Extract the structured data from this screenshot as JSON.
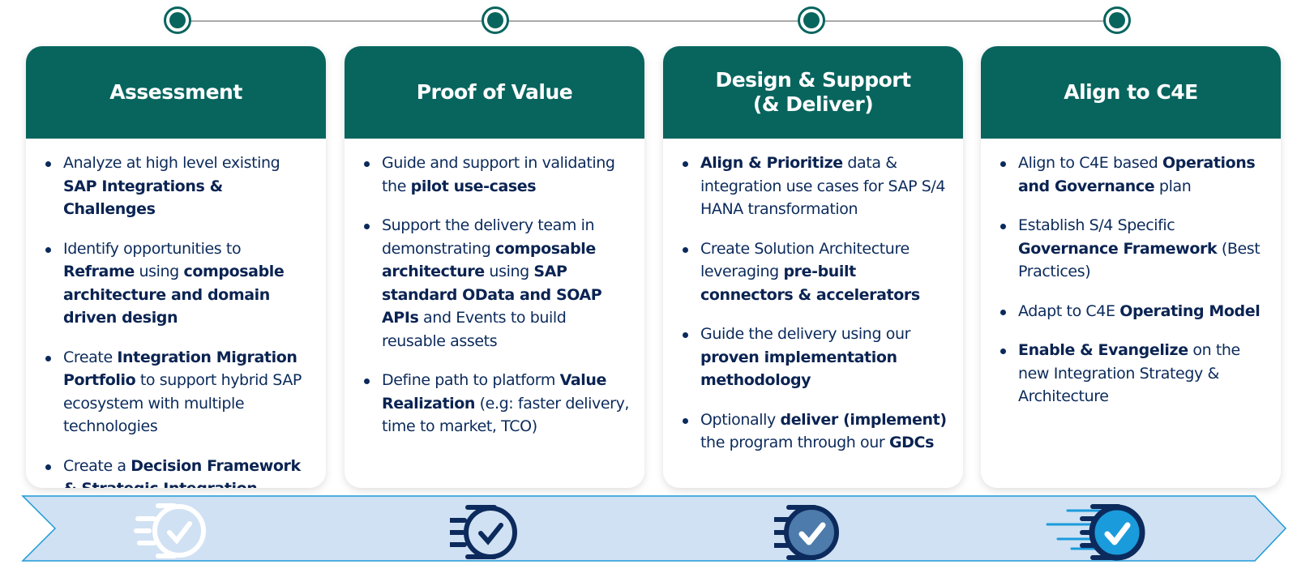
{
  "colors": {
    "header_bg": "#08655e",
    "header_text": "#ffffff",
    "body_text": "#0b2a5b",
    "ribbon_fill": "#d0e1f3",
    "ribbon_stroke": "#1e9ad6",
    "icon_navy": "#0c2a5c",
    "icon_mid_blue": "#4d7bab",
    "icon_bright_blue": "#1a9bdb",
    "timeline_line": "#a9a9a9"
  },
  "phases": [
    {
      "title": "Assessment",
      "icon": "speed-check-icon-faded",
      "bullets": [
        [
          {
            "t": "Analyze at high level existing "
          },
          {
            "t": "SAP Integrations & Challenges",
            "b": true
          }
        ],
        [
          {
            "t": "Identify opportunities to "
          },
          {
            "t": "Reframe",
            "b": true
          },
          {
            "t": " using "
          },
          {
            "t": "composable architecture and domain driven design",
            "b": true
          }
        ],
        [
          {
            "t": "Create "
          },
          {
            "t": "Integration Migration Portfolio",
            "b": true
          },
          {
            "t": " to support hybrid SAP ecosystem with multiple technologies"
          }
        ],
        [
          {
            "t": "Create a "
          },
          {
            "t": "Decision Framework & Strategic Integration Roadmap",
            "b": true
          }
        ]
      ]
    },
    {
      "title": "Proof of Value",
      "icon": "speed-check-icon-outline",
      "bullets": [
        [
          {
            "t": "Guide and support in validating the "
          },
          {
            "t": "pilot use-cases",
            "b": true
          }
        ],
        [
          {
            "t": "Support the delivery team in demonstrating "
          },
          {
            "t": "composable architecture",
            "b": true
          },
          {
            "t": " using  "
          },
          {
            "t": "SAP standard OData and SOAP APIs",
            "b": true
          },
          {
            "t": " and Events to build reusable assets"
          }
        ],
        [
          {
            "t": "Define path to platform "
          },
          {
            "t": "Value Realization",
            "b": true
          },
          {
            "t": " (e.g: faster delivery, time to market, TCO)"
          }
        ]
      ]
    },
    {
      "title": "Design & Support\n(& Deliver)",
      "icon": "speed-check-icon-filled-mid",
      "bullets": [
        [
          {
            "t": "Align & Prioritize",
            "b": true
          },
          {
            "t": " data & integration use cases for SAP S/4 HANA transformation"
          }
        ],
        [
          {
            "t": "Create Solution Architecture leveraging "
          },
          {
            "t": "pre-built connectors & accelerators",
            "b": true
          }
        ],
        [
          {
            "t": "Guide the delivery using our "
          },
          {
            "t": "proven implementation methodology",
            "b": true
          }
        ],
        [
          {
            "t": "Optionally "
          },
          {
            "t": "deliver (implement)",
            "b": true
          },
          {
            "t": " the program through our "
          },
          {
            "t": "GDCs",
            "b": true
          }
        ]
      ]
    },
    {
      "title": "Align to C4E",
      "icon": "speed-check-icon-filled-bright",
      "bullets": [
        [
          {
            "t": "Align to C4E based "
          },
          {
            "t": "Operations and Governance",
            "b": true
          },
          {
            "t": " plan"
          }
        ],
        [
          {
            "t": "Establish S/4 Specific "
          },
          {
            "t": "Governance Framework",
            "b": true
          },
          {
            "t": " (Best Practices)"
          }
        ],
        [
          {
            "t": "Adapt to C4E "
          },
          {
            "t": "Operating Model",
            "b": true
          }
        ],
        [
          {
            "t": "Enable & Evangelize",
            "b": true
          },
          {
            "t": " on the new Integration Strategy & Architecture"
          }
        ]
      ]
    }
  ]
}
